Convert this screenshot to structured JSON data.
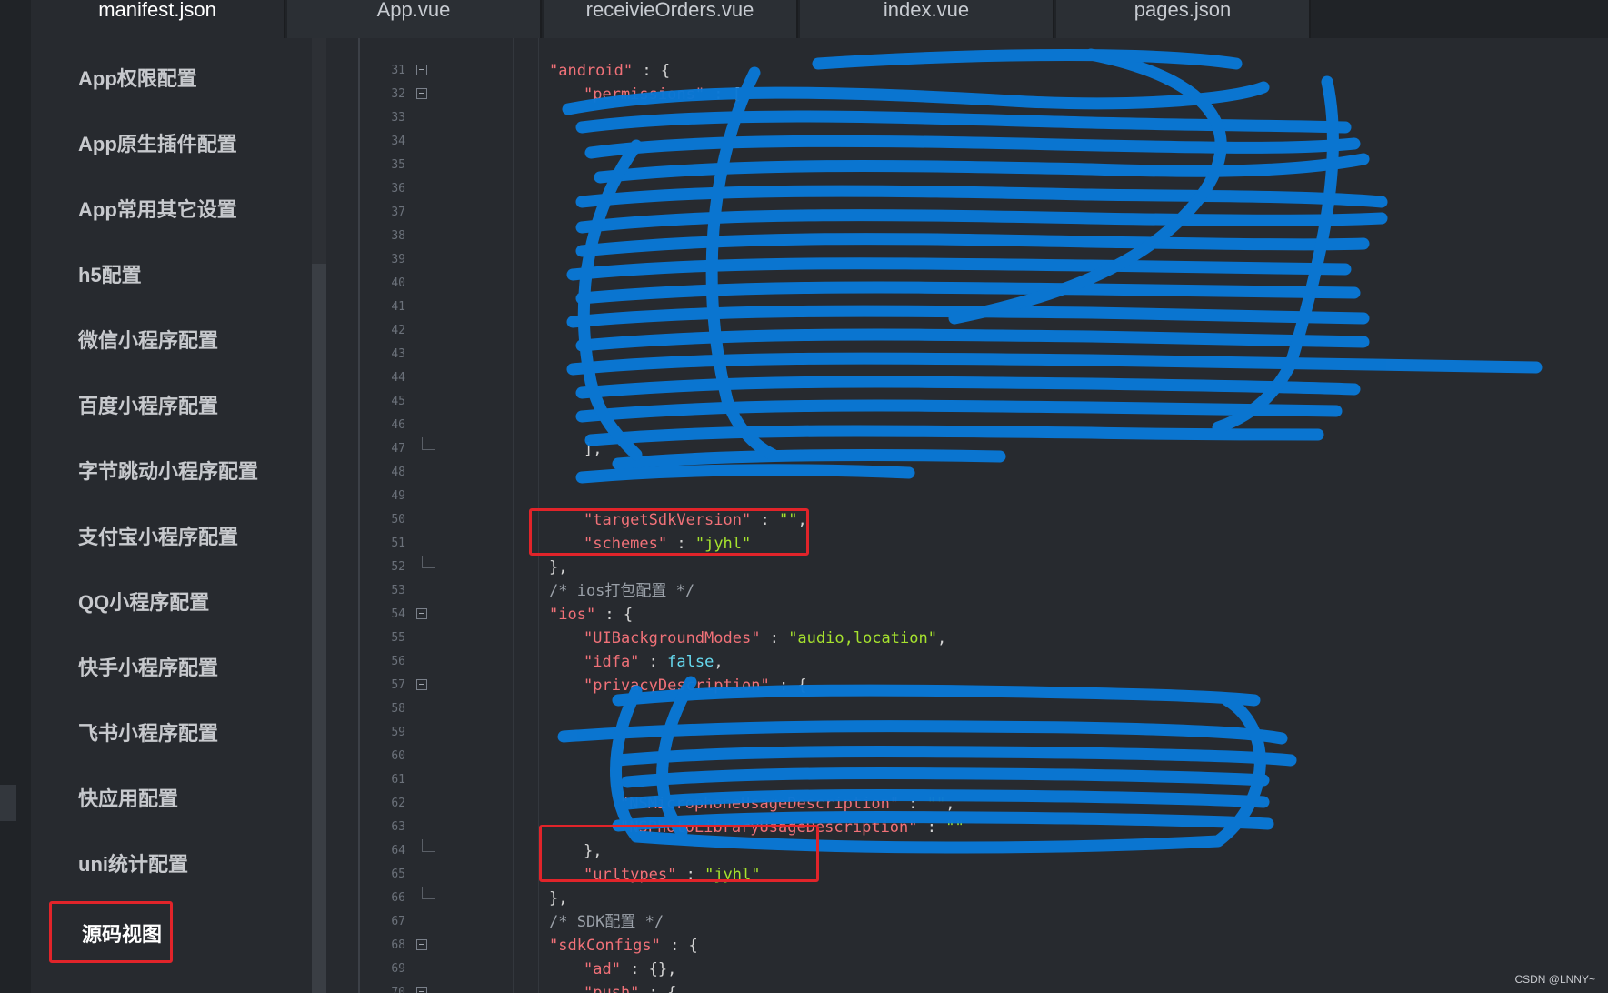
{
  "tabs": [
    {
      "label": "manifest.json",
      "active": true
    },
    {
      "label": "App.vue"
    },
    {
      "label": "receivieOrders.vue"
    },
    {
      "label": "index.vue"
    },
    {
      "label": "pages.json"
    }
  ],
  "sidebar": {
    "items": [
      {
        "label": "App权限配置"
      },
      {
        "label": "App原生插件配置"
      },
      {
        "label": "App常用其它设置"
      },
      {
        "label": "h5配置"
      },
      {
        "label": "微信小程序配置"
      },
      {
        "label": "百度小程序配置"
      },
      {
        "label": "字节跳动小程序配置"
      },
      {
        "label": "支付宝小程序配置"
      },
      {
        "label": "QQ小程序配置"
      },
      {
        "label": "快手小程序配置"
      },
      {
        "label": "飞书小程序配置"
      },
      {
        "label": "快应用配置"
      },
      {
        "label": "uni统计配置"
      },
      {
        "label": "源码视图",
        "selected": true
      }
    ]
  },
  "editor": {
    "lines": [
      {
        "n": "31",
        "text": "\"android\" : {"
      },
      {
        "n": "32",
        "text": "\"permissions\" : ["
      },
      {
        "n": "33",
        "text": ""
      },
      {
        "n": "34",
        "text": ""
      },
      {
        "n": "35",
        "text": ""
      },
      {
        "n": "36",
        "text": ""
      },
      {
        "n": "37",
        "text": ""
      },
      {
        "n": "38",
        "text": ""
      },
      {
        "n": "39",
        "text": ""
      },
      {
        "n": "40",
        "text": ""
      },
      {
        "n": "41",
        "text": ""
      },
      {
        "n": "42",
        "text": ""
      },
      {
        "n": "43",
        "text": ""
      },
      {
        "n": "44",
        "text": ""
      },
      {
        "n": "45",
        "text": ""
      },
      {
        "n": "46",
        "text": ""
      },
      {
        "n": "47",
        "text": "],"
      },
      {
        "n": "48",
        "text": ""
      },
      {
        "n": "49",
        "text": ""
      },
      {
        "n": "50",
        "text": "\"targetSdkVersion\" : \"\","
      },
      {
        "n": "51",
        "text": "\"schemes\" : \"jyhl\""
      },
      {
        "n": "52",
        "text": "},"
      },
      {
        "n": "53",
        "text": "/* ios打包配置 */"
      },
      {
        "n": "54",
        "text": "\"ios\" : {"
      },
      {
        "n": "55",
        "text": "\"UIBackgroundModes\" : \"audio,location\","
      },
      {
        "n": "56",
        "text": "\"idfa\" : false,"
      },
      {
        "n": "57",
        "text": "\"privacyDescription\" : {"
      },
      {
        "n": "58",
        "text": ""
      },
      {
        "n": "59",
        "text": ""
      },
      {
        "n": "60",
        "text": ""
      },
      {
        "n": "61",
        "text": ""
      },
      {
        "n": "62",
        "text": "\"NSMicrophoneUsageDescription\" : \"\","
      },
      {
        "n": "63",
        "text": "\"NSPhotoLibraryUsageDescription\" : \"\""
      },
      {
        "n": "64",
        "text": "},"
      },
      {
        "n": "65",
        "text": "\"urltypes\" : \"jyhl\""
      },
      {
        "n": "66",
        "text": "},"
      },
      {
        "n": "67",
        "text": "/* SDK配置 */"
      },
      {
        "n": "68",
        "text": "\"sdkConfigs\" : {"
      },
      {
        "n": "69",
        "text": "\"ad\" : {},"
      },
      {
        "n": "70",
        "text": "\"push\" : {"
      }
    ]
  },
  "colors": {
    "background": "#272a2f",
    "annotation_red": "#e1242a",
    "scribble_blue": "#0a78d6",
    "string_green": "#a6e22e",
    "key_red": "#f07178"
  },
  "watermark": "CSDN @LNNY~"
}
